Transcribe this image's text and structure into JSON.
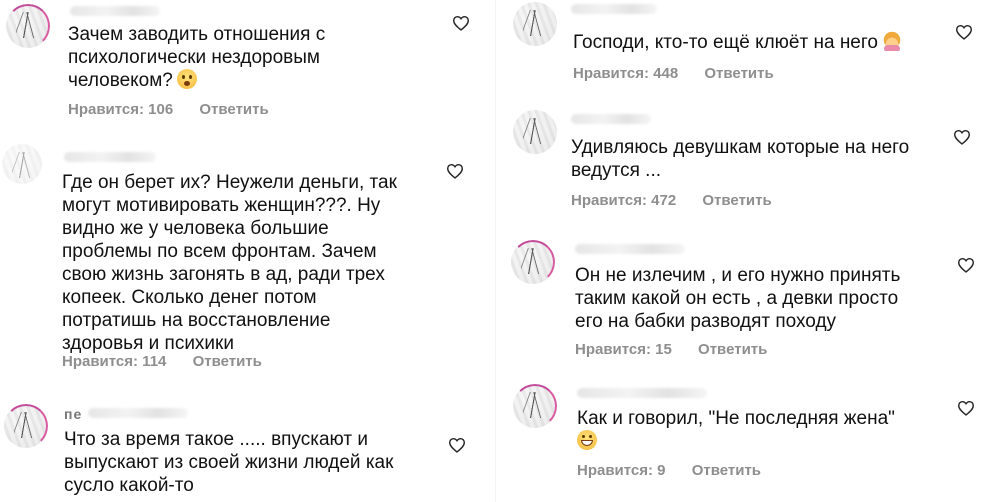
{
  "left_column": {
    "comments": [
      {
        "lines": [
          "Зачем заводить отношения с",
          "психологически нездоровым",
          "человеком?"
        ],
        "emoji": "fearful-face",
        "likes": "Нравится: 106",
        "reply": "Ответить"
      },
      {
        "lines": [
          "Где он берет их?  Неужели деньги, так",
          "могут мотивировать женщин???. Ну",
          "видно же у человека большие",
          "проблемы по всем фронтам. Зачем",
          "свою жизнь загонять в ад, ради трех",
          "копеек. Сколько денег потом",
          "потратишь на восстановление",
          "здоровья и психики"
        ],
        "likes": "Нравится: 114",
        "reply": "Ответить"
      },
      {
        "name_fragment": "пе",
        "lines": [
          "Что за время такое ..... впускают и",
          "выпускают из своей жизни людей как",
          "сусло какой-то"
        ]
      }
    ]
  },
  "right_column": {
    "comments": [
      {
        "lines": [
          "Господи, кто-то ещё клюёт на него"
        ],
        "emoji": "woman-facepalming",
        "likes": "Нравится: 448",
        "reply": "Ответить"
      },
      {
        "lines": [
          "Удивляюсь девушкам которые на него",
          "ведутся ..."
        ],
        "likes": "Нравится: 472",
        "reply": "Ответить"
      },
      {
        "lines": [
          "Он не излечим , и его нужно принять",
          "таким какой он есть , а девки просто",
          "его на бабки разводят походу"
        ],
        "likes": "Нравится: 15",
        "reply": "Ответить"
      },
      {
        "lines": [
          "Как и говорил, \"Не последняя жена\""
        ],
        "emoji": "grinning-face",
        "likes": "Нравится: 9",
        "reply": "Ответить"
      }
    ]
  },
  "icons": {
    "like": "heart-outline-icon",
    "avatar": "avatar-image"
  },
  "colors": {
    "text": "#111111",
    "meta": "#8e8e8e",
    "heart": "#262626",
    "avatar_ring": "#c44b9b"
  }
}
